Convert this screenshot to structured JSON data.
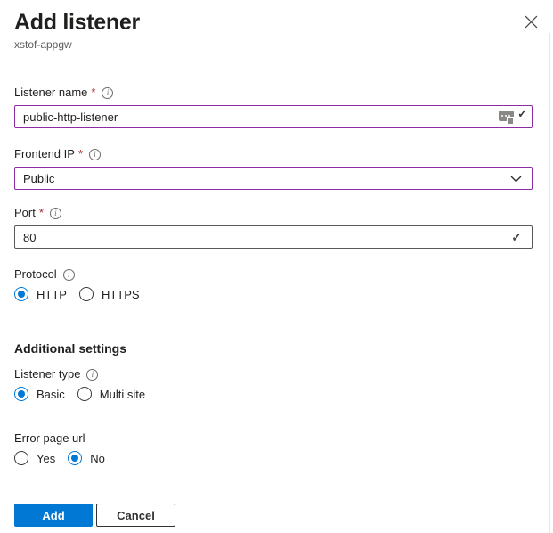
{
  "header": {
    "title": "Add listener",
    "subtitle": "xstof-appgw"
  },
  "fields": {
    "listener_name": {
      "label": "Listener name",
      "required": "*",
      "value": "public-http-listener"
    },
    "frontend_ip": {
      "label": "Frontend IP",
      "required": "*",
      "value": "Public"
    },
    "port": {
      "label": "Port",
      "required": "*",
      "value": "80"
    },
    "protocol": {
      "label": "Protocol",
      "options": [
        "HTTP",
        "HTTPS"
      ],
      "selected": "HTTP"
    },
    "listener_type": {
      "label": "Listener type",
      "options": [
        "Basic",
        "Multi site"
      ],
      "selected": "Basic"
    },
    "error_page_url": {
      "label": "Error page url",
      "options": [
        "Yes",
        "No"
      ],
      "selected": "No"
    }
  },
  "sections": {
    "additional_settings": "Additional settings"
  },
  "footer": {
    "add": "Add",
    "cancel": "Cancel"
  },
  "icons": {
    "info_glyph": "i",
    "check_glyph": "✓"
  },
  "colors": {
    "accent": "#0078d4",
    "focused_input_border": "#8a2da5",
    "input_border": "#5c5a58",
    "required_asterisk": "#a4262c",
    "text_primary": "#201f1e",
    "text_secondary": "#605e5c"
  }
}
